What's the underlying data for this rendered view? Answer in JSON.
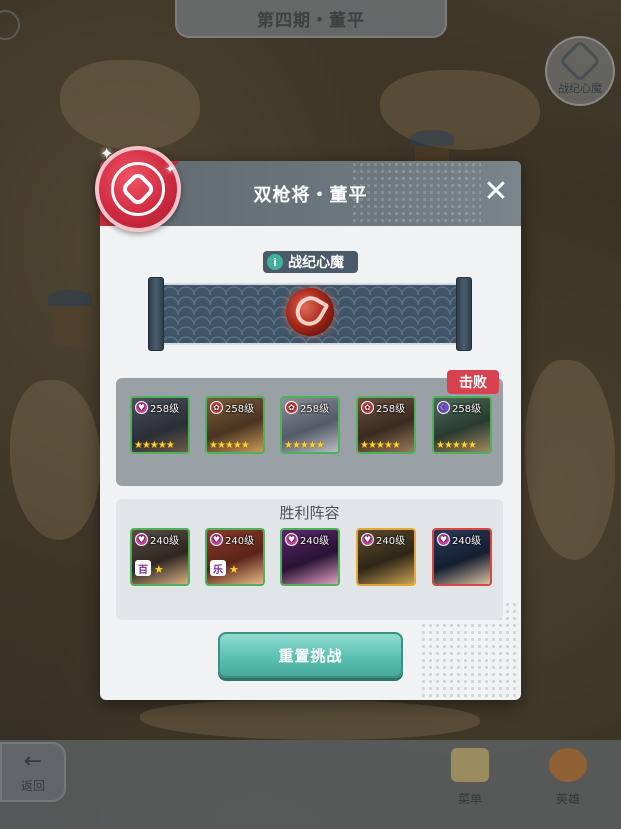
{
  "header": {
    "period_title": "第四期・董平"
  },
  "record_button": {
    "label": "战纪心魔",
    "icon": "hexagon-emblem-icon"
  },
  "dialog": {
    "title": "双枪将・董平",
    "close_icon": "close-icon",
    "emblem_icon": "knot-emblem-icon",
    "boss": {
      "tag_label": "战纪心魔",
      "info_icon": "i",
      "portrait": "boss-swirl-portrait"
    },
    "enemy": {
      "badge": "击败",
      "heroes": [
        {
          "level": "258级",
          "element": "heart",
          "element_color": "#c94aa6",
          "stars": "★★★★★"
        },
        {
          "level": "258级",
          "element": "flower",
          "element_color": "#d8403e",
          "stars": "★★★★★"
        },
        {
          "level": "258级",
          "element": "flower",
          "element_color": "#d8403e",
          "stars": "★★★★★"
        },
        {
          "level": "258级",
          "element": "flower",
          "element_color": "#d8403e",
          "stars": "★★★★★"
        },
        {
          "level": "258级",
          "element": "moon",
          "element_color": "#6b4fc2",
          "stars": "★★★★★"
        }
      ]
    },
    "victory": {
      "title": "胜利阵容",
      "heroes": [
        {
          "level": "240级",
          "element": "heart",
          "element_color": "#c94aa6",
          "tag": "百",
          "stars": "★"
        },
        {
          "level": "240级",
          "element": "heart",
          "element_color": "#c94aa6",
          "tag": "乐",
          "stars": "★"
        },
        {
          "level": "240级",
          "element": "heart",
          "element_color": "#c94aa6",
          "tag": "",
          "stars": ""
        },
        {
          "level": "240级",
          "element": "heart",
          "element_color": "#c94aa6",
          "tag": "",
          "stars": ""
        },
        {
          "level": "240级",
          "element": "heart",
          "element_color": "#c94aa6",
          "tag": "",
          "stars": ""
        }
      ]
    },
    "reset_button": "重置挑战"
  },
  "bottom_bar": {
    "back_label": "返回",
    "back_icon": "arrow-left-icon",
    "menu_label": "菜单",
    "heroes_label": "英雄"
  },
  "colors": {
    "accent_red": "#d84150",
    "button_teal": "#5cc1b2",
    "header_slate": "#5e6970",
    "panel_gray": "#9aa1a6"
  }
}
